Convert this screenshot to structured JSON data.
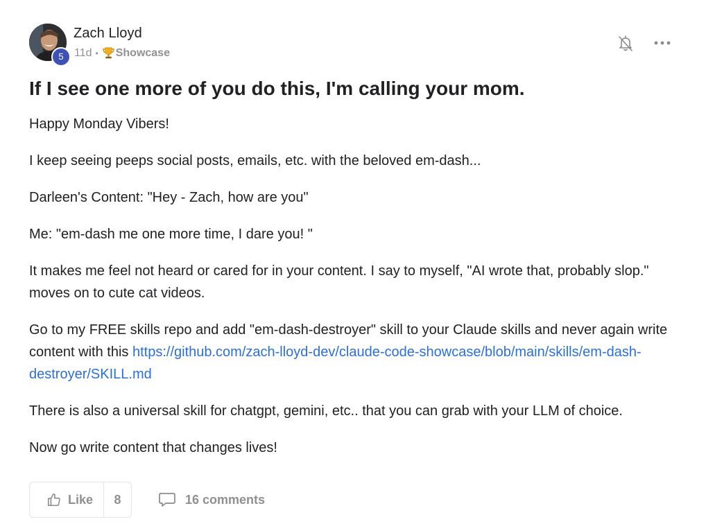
{
  "post": {
    "author": {
      "name": "Zach Lloyd",
      "level": "5"
    },
    "meta": {
      "age": "11d",
      "separator": "•",
      "category": "Showcase"
    },
    "title": "If I see one more of you do this, I'm calling your mom.",
    "body": {
      "p1": "Happy Monday Vibers!",
      "p2": "I keep seeing peeps social posts, emails, etc. with the beloved em-dash...",
      "p3": "Darleen's Content: \"Hey - Zach, how are you\"",
      "p4": "Me: \"em-dash me one more time, I dare you! \"",
      "p5": "It makes me feel not heard or cared for in your content. I say to myself, \"AI wrote that, probably slop.\" moves on to cute cat videos.",
      "p6_text": "Go to my FREE skills repo and add \"em-dash-destroyer\" skill to your Claude skills and never again write content with this ",
      "p6_link": "https://github.com/zach-lloyd-dev/claude-code-showcase/blob/main/skills/em-dash-destroyer/SKILL.md",
      "p7": "There is also a universal skill for chatgpt, gemini, etc.. that you can grab with your LLM of choice.",
      "p8": "Now go write content that changes lives!"
    },
    "footer": {
      "like_label": "Like",
      "like_count": "8",
      "comments_label": "16 comments"
    }
  },
  "colors": {
    "text": "#202124",
    "muted": "#909090",
    "link": "#2a6fdb",
    "badge": "#3f51b5",
    "border": "#e4e4e4"
  },
  "icons": {
    "bell": "bell-off-icon",
    "more": "more-horizontal-icon",
    "trophy": "trophy-icon",
    "like": "thumbs-up-icon",
    "comment": "comment-icon"
  }
}
